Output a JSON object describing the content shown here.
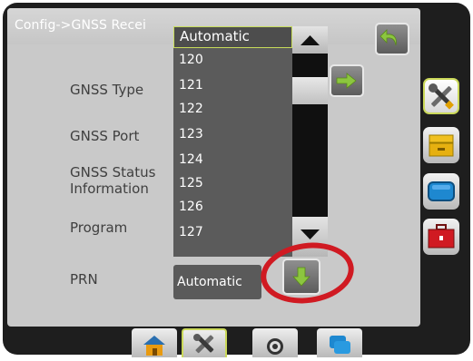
{
  "title": "Config->GNSS Recei",
  "labels": {
    "gnss_type": "GNSS Type",
    "gnss_port": "GNSS Port",
    "gnss_status_line1": "GNSS Status",
    "gnss_status_line2": "Information",
    "program": "Program",
    "prn": "PRN"
  },
  "dropdown": {
    "selected": "Automatic",
    "options": [
      "120",
      "121",
      "122",
      "123",
      "124",
      "125",
      "126",
      "127"
    ]
  },
  "prn_value": "Automatic",
  "icons": {
    "back": "back-arrow-icon",
    "next": "right-arrow-icon",
    "prn_down": "down-arrow-icon",
    "scroll_up": "triangle-up-icon",
    "scroll_down": "triangle-down-icon",
    "side_tabs": [
      "tools-icon",
      "folder-icon",
      "display-icon",
      "toolbox-icon"
    ],
    "bottom_tabs": [
      "home-icon",
      "tools-icon",
      "sensor-icon",
      "layers-icon"
    ]
  },
  "colors": {
    "accent_green": "#8cc63f",
    "highlight_red": "#d01a22",
    "selection_outline": "#c7dc5a"
  }
}
